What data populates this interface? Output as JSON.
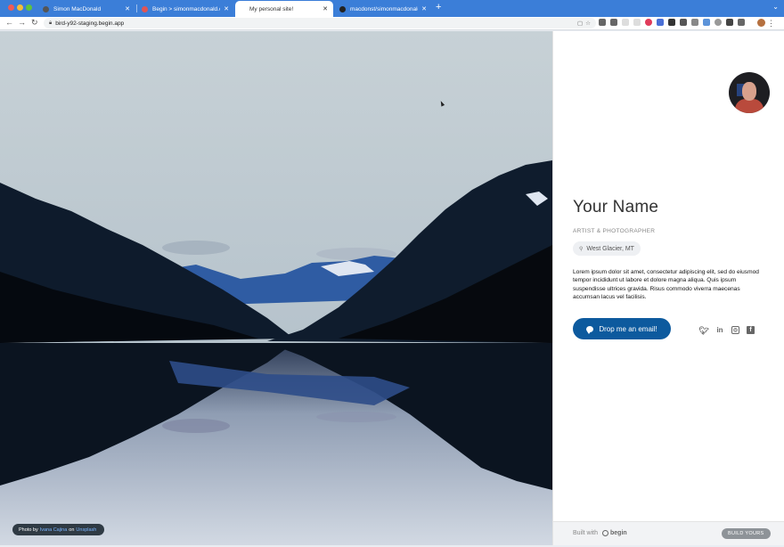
{
  "browser": {
    "tabs": [
      {
        "title": "Simon MacDonald",
        "active": false
      },
      {
        "title": "Begin > simonmacdonald.com",
        "active": false
      },
      {
        "title": "My personal site!",
        "active": true
      },
      {
        "title": "macdonst/simonmacdonald.co",
        "active": false
      }
    ],
    "url": "bird-y92-staging.begin.app"
  },
  "hero": {
    "credit_prefix": "Photo by",
    "credit_author": "Ivana Cajina",
    "credit_on": "on",
    "credit_source": "Unsplash"
  },
  "profile": {
    "name": "Your Name",
    "role": "ARTIST & PHOTOGRAPHER",
    "location": "West Glacier, MT",
    "bio": "Lorem ipsum dolor sit amet, consectetur adipiscing elit, sed do eiusmod tempor incididunt ut labore et dolore magna aliqua. Quis ipsum suspendisse ultrices gravida. Risus commodo viverra maecenas accumsan lacus vel facilisis.",
    "email_button": "Drop me an email!",
    "socials": [
      "twitter-icon",
      "linkedin-icon",
      "instagram-icon",
      "facebook-icon"
    ]
  },
  "footer": {
    "built_with": "Built with",
    "brand": "begin",
    "build_button": "BUILD YOURS"
  },
  "colors": {
    "accent": "#0d5a9e",
    "tabstrip": "#3b7ed8"
  }
}
